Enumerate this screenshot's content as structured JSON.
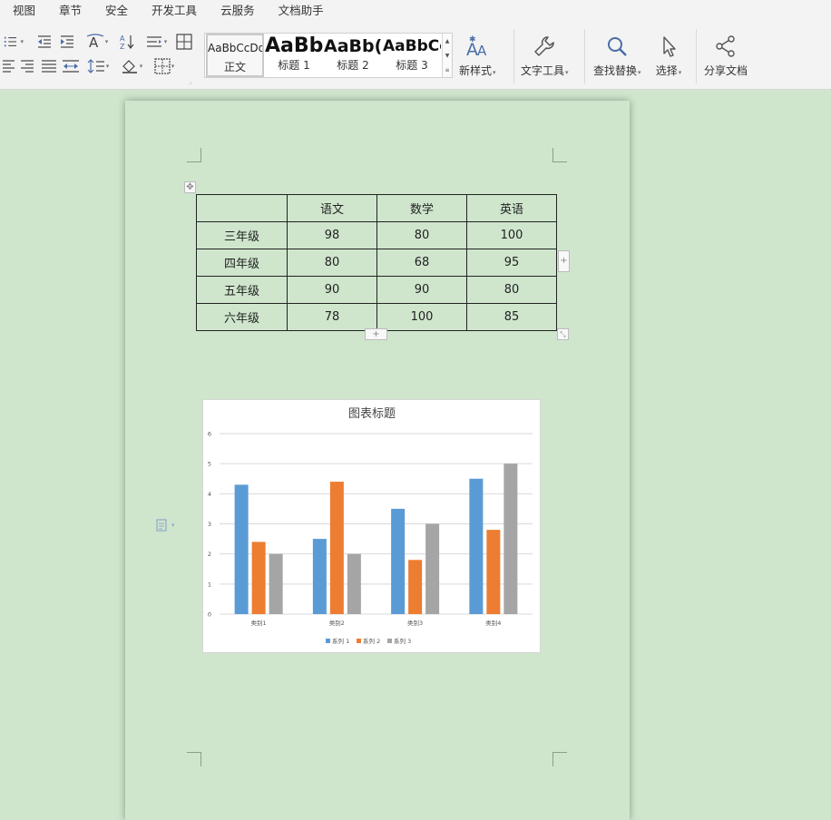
{
  "menu": {
    "items": [
      "视图",
      "章节",
      "安全",
      "开发工具",
      "云服务",
      "文档助手"
    ]
  },
  "ribbon": {
    "styles": [
      {
        "preview": "AaBbCcDd",
        "name": "正文"
      },
      {
        "preview": "AaBb",
        "name": "标题 1"
      },
      {
        "preview": "AaBb(",
        "name": "标题 2"
      },
      {
        "preview": "AaBbCc",
        "name": "标题 3"
      }
    ],
    "buttons": {
      "new_style": "新样式",
      "text_tools": "文字工具",
      "find_replace": "查找替换",
      "select": "选择",
      "share": "分享文档"
    }
  },
  "table": {
    "headers": [
      "",
      "语文",
      "数学",
      "英语"
    ],
    "rows": [
      [
        "三年级",
        "98",
        "80",
        "100"
      ],
      [
        "四年级",
        "80",
        "68",
        "95"
      ],
      [
        "五年级",
        "90",
        "90",
        "80"
      ],
      [
        "六年级",
        "78",
        "100",
        "85"
      ]
    ]
  },
  "chart_data": {
    "type": "bar",
    "title": "图表标题",
    "categories": [
      "类别1",
      "类别2",
      "类别3",
      "类别4"
    ],
    "series": [
      {
        "name": "系列 1",
        "values": [
          4.3,
          2.5,
          3.5,
          4.5
        ],
        "color": "#5b9bd5"
      },
      {
        "name": "系列 2",
        "values": [
          2.4,
          4.4,
          1.8,
          2.8
        ],
        "color": "#ed7d31"
      },
      {
        "name": "系列 3",
        "values": [
          2,
          2,
          3,
          5
        ],
        "color": "#a5a5a5"
      }
    ],
    "ylim": [
      0,
      6
    ],
    "yticks": [
      "0",
      "1",
      "2",
      "3",
      "4",
      "5",
      "6"
    ],
    "grid": true,
    "legend": "bottom"
  },
  "icons": {
    "table_add_handle": "+"
  }
}
